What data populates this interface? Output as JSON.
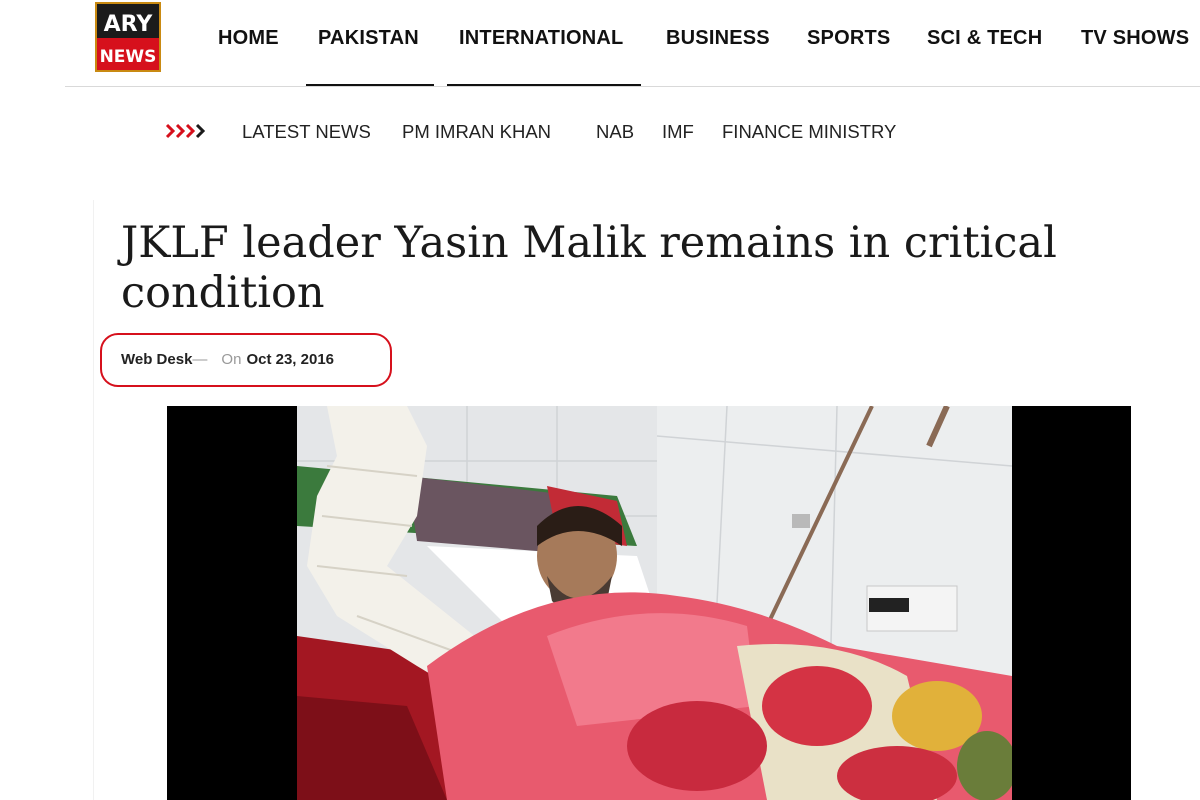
{
  "logo": {
    "line1": "ARY",
    "line2": "NEWS"
  },
  "nav": {
    "items": [
      {
        "label": "HOME"
      },
      {
        "label": "PAKISTAN"
      },
      {
        "label": "INTERNATIONAL"
      },
      {
        "label": "BUSINESS"
      },
      {
        "label": "SPORTS"
      },
      {
        "label": "SCI & TECH"
      },
      {
        "label": "TV SHOWS"
      }
    ]
  },
  "trending": {
    "icon": "triple-chevron-right-icon",
    "items": [
      {
        "label": "LATEST NEWS"
      },
      {
        "label": "PM IMRAN KHAN"
      },
      {
        "label": "NAB"
      },
      {
        "label": "IMF"
      },
      {
        "label": "FINANCE MINISTRY"
      }
    ]
  },
  "article": {
    "headline": "JKLF leader Yasin Malik remains in critical condition",
    "author": "Web Desk",
    "author_separator": "—",
    "date_prefix": "On",
    "date": "Oct 23, 2016"
  },
  "colors": {
    "brand_red": "#d6101c",
    "text": "#1a1a1a",
    "muted": "#999999"
  }
}
